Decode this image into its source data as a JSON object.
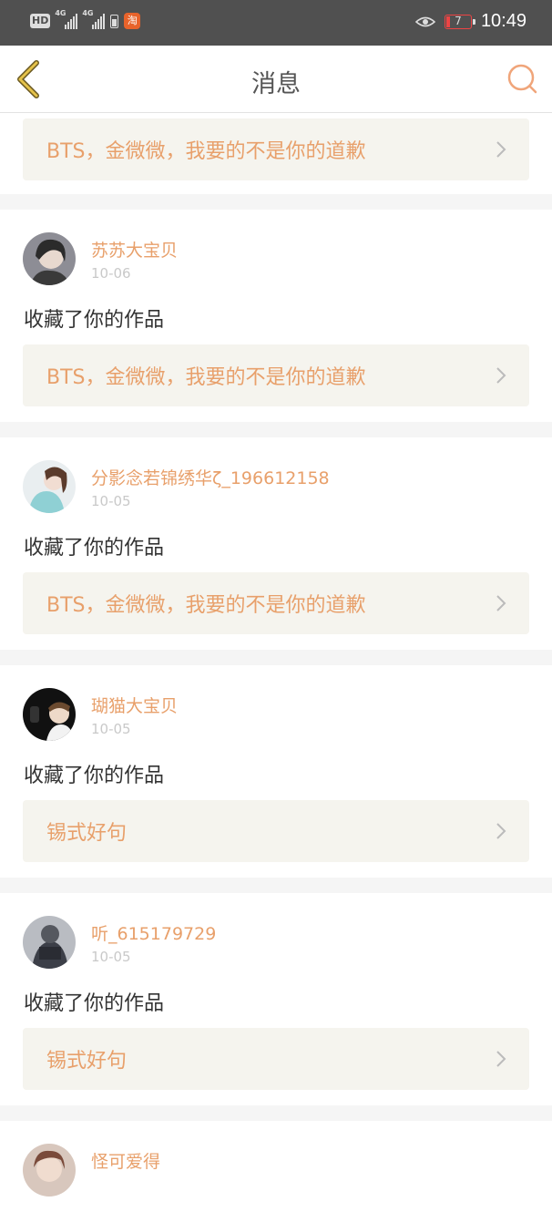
{
  "status_bar": {
    "hd": "HD",
    "net1": "4G",
    "net2": "4G",
    "app_badge": "淘",
    "battery_level": "7",
    "time": "10:49"
  },
  "nav": {
    "title": "消息",
    "back_icon": "chevron-left-icon",
    "search_icon": "search-icon"
  },
  "colors": {
    "accent": "#e8a06b",
    "back_icon": "#d9b23c",
    "card_bg": "#f5f4ee"
  },
  "first_card": {
    "work_title": "BTS，金微微，我要的不是你的道歉"
  },
  "messages": [
    {
      "username": "苏苏大宝贝",
      "date": "10-06",
      "action": "收藏了你的作品",
      "work_title": "BTS，金微微，我要的不是你的道歉"
    },
    {
      "username": "分影念若锦绣华ζ_196612158",
      "date": "10-05",
      "action": "收藏了你的作品",
      "work_title": "BTS，金微微，我要的不是你的道歉"
    },
    {
      "username": "瑚猫大宝贝",
      "date": "10-05",
      "action": "收藏了你的作品",
      "work_title": "锡式好句"
    },
    {
      "username": "听_615179729",
      "date": "10-05",
      "action": "收藏了你的作品",
      "work_title": "锡式好句"
    },
    {
      "username": "怪可爱得"
    }
  ]
}
